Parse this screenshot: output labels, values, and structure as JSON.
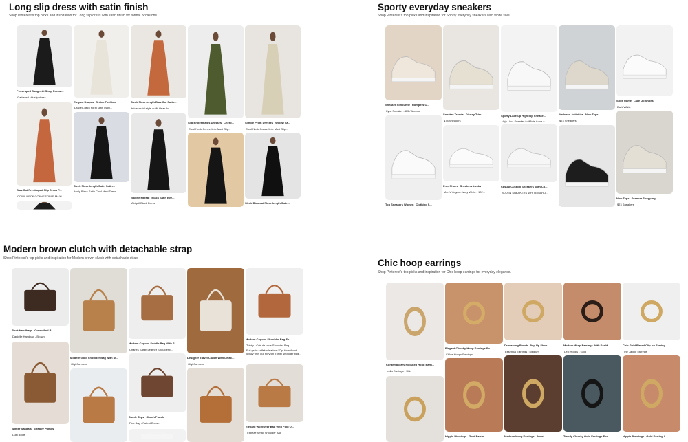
{
  "colors": {
    "background": "#ffffff",
    "title": "#111111",
    "subtitle": "#444444"
  },
  "sections": [
    {
      "id": "dress",
      "title": "Long slip dress with satin finish",
      "subtitle": "Shop Pinterest's top picks and inspiration for Long slip dress with satin finish for formal occasions.",
      "columns": [
        [
          {
            "chips": [
              "Pre-draped Spaghetti Strap Forma..."
            ],
            "caption": "Gathered silk slip dress",
            "bg": "#ececec",
            "fig": "#1b1b1b"
          },
          {
            "chips": [
              "Bias Cut Pre-draped Slip Dress F..."
            ],
            "caption": "COWL-NECK CONVERTIBLE MAXI...",
            "bg": "#eeeae6",
            "fig": "#c4673e"
          },
          {
            "chips": [],
            "caption": "",
            "bg": "#f2f2f2",
            "fig": "#1d1d1d"
          }
        ],
        [
          {
            "chips": [
              "Elegant Drapes",
              "Online Fashion"
            ],
            "caption": "Draped-neck floral satin maxi...",
            "bg": "#f0efec",
            "fig": "#e9e4d9"
          },
          {
            "chips": [
              "Sleek Floor-length Satin Satin..."
            ],
            "caption": "Holly Black Satin Cowl Maxi Dress...",
            "bg": "#d9dde3",
            "fig": "#151515"
          }
        ],
        [
          {
            "chips": [
              "Sleek Floor-length Bias Cut Satin..."
            ],
            "caption": "bridesmaid style outfit ideas for...",
            "bg": "#eae7e3",
            "fig": "#c4683d"
          },
          {
            "chips": [
              "Nadine Merabi",
              "Black Satin Eve..."
            ],
            "caption": "Abigail Black Dress",
            "bg": "#e8e8e8",
            "fig": "#161616"
          }
        ],
        [
          {
            "chips": [
              "Slip Bridesmaids Dresses",
              "Chero..."
            ],
            "caption": "Cowl-Neck Convertible Maxi Slip...",
            "bg": "#ededed",
            "fig": "#4d5b2e"
          },
          {
            "chips": [],
            "caption": "",
            "bg": "#e2c8a3",
            "fig": "#151515"
          }
        ],
        [
          {
            "chips": [
              "Simple Prom Dresses",
              "Willow Sa..."
            ],
            "caption": "Cowl-Neck Convertible Maxi Slip...",
            "bg": "#e8e5e1",
            "fig": "#d8cfb7"
          },
          {
            "chips": [
              "Sleek Bias-cut Floor-length Satin..."
            ],
            "caption": "",
            "bg": "#e4e4e4",
            "fig": "#101010"
          }
        ]
      ]
    },
    {
      "id": "sneakers",
      "title": "Sporty everyday sneakers",
      "subtitle": "Shop Pinterest's top picks and inspiration for Sporty everyday sneakers with white sole.",
      "columns": [
        [
          {
            "chips": [
              "Sneaker Silhouette",
              "Rompers O..."
            ],
            "caption": "Kyra Sneaker - 8.5 / Almond",
            "bg": "#e2d5c6",
            "fig": "#efe7dc"
          },
          {
            "chips": [
              "Top Sneakers Women",
              "Clothing S..."
            ],
            "caption": "",
            "bg": "#efefef",
            "fig": "#fafafa"
          }
        ],
        [
          {
            "chips": [
              "Sneaker Trends",
              "Disney Trim"
            ],
            "caption": "$74 Sneakers",
            "bg": "#e9e6e1",
            "fig": "#e6e0d2"
          },
          {
            "chips": [
              "Free Shoes",
              "Sneakers Looks"
            ],
            "caption": "Men's Vegan - Ivory White - 13 /...",
            "bg": "#f1f1f1",
            "fig": "#fbfbfb"
          }
        ],
        [
          {
            "chips": [
              "Sporty Lace-up High-top Sneake..."
            ],
            "caption": "Veja Urca Sneaker in White Aqua a...",
            "bg": "#f3f3f3",
            "fig": "#f8f8f8"
          },
          {
            "chips": [
              "Casual Custom Sneakers With Co..."
            ],
            "caption": "BODEN SNEAKERS WHITE MARO...",
            "bg": "#eeeeee",
            "fig": "#f6f6f6"
          }
        ],
        [
          {
            "chips": [
              "Wellness Activities",
              "New Tops"
            ],
            "caption": "$74 Sneakers",
            "bg": "#cfd3d6",
            "fig": "#ddd8cb"
          },
          {
            "chips": [],
            "caption": "",
            "bg": "#e6e6e6",
            "fig": "#1d1d1d"
          }
        ],
        [
          {
            "chips": [
              "Shoe Game",
              "Lace Up Shoes"
            ],
            "caption": "Dark White",
            "bg": "#f2f2f2",
            "fig": "#fbfbfb"
          },
          {
            "chips": [
              "New Tops",
              "Sneaker Shopping"
            ],
            "caption": "$74 Sneakers",
            "bg": "#d9d5cf",
            "fig": "#e4dfd4"
          }
        ]
      ]
    },
    {
      "id": "clutch",
      "title": "Modern brown clutch with detachable strap",
      "subtitle": "Shop Pinterest's top picks and inspiration for Modern brown clutch with detachable strap.",
      "columns": [
        [
          {
            "chips": [
              "Rock Handbags",
              "Green And B..."
            ],
            "caption": "Danielle Handbag - Brown",
            "bg": "#ececec",
            "fig": "#3d2a20"
          },
          {
            "chips": [
              "Winter Sandals",
              "Strappy Pumps"
            ],
            "caption": "Lulu Boots",
            "bg": "#e5ddd5",
            "fig": "#8a5a34"
          }
        ],
        [
          {
            "chips": [
              "Modern Gold Shoulder Bag With St..."
            ],
            "caption": "Gigi Carmelo",
            "bg": "#e0dcd6",
            "fig": "#b8804a"
          },
          {
            "chips": [],
            "caption": "",
            "bg": "#e9edf0",
            "fig": "#b97a45"
          }
        ],
        [
          {
            "chips": [
              "Modern Cognac Saddle Bag With S..."
            ],
            "caption": "Charles Safari Leather Shoulder B...",
            "bg": "#eeeeee",
            "fig": "#a86e43"
          },
          {
            "chips": [
              "Suede Tops",
              "Clutch Pouch"
            ],
            "caption": "Flex Bag - Patent Brown",
            "bg": "#eeeeee",
            "fig": "#6e4632"
          },
          {
            "chips": [],
            "caption": "",
            "bg": "#f2f2f2",
            "fig": "#f5f5f5"
          }
        ],
        [
          {
            "chips": [
              "Designer Travel Clutch With Detac..."
            ],
            "caption": "Gigi Carmelo",
            "bg": "#9e6a3e",
            "fig": "#e8e2d9"
          },
          {
            "chips": [],
            "caption": "",
            "bg": "#e3ddd6",
            "fig": "#b36f37"
          }
        ],
        [
          {
            "chips": [
              "Modern Cognac Shoulder Bag Fo..."
            ],
            "caption": "Trinity • Cuir de vous Shoulder Bag",
            "bg": "#efefef",
            "fig": "#b2683c"
          },
          {
            "chips": [
              "Elegant Workwear Bag With Fold O..."
            ],
            "caption": "Trapeze Small Shoulder Bag",
            "bg": "#e2ddd6",
            "fig": "#b97a45"
          }
        ]
      ],
      "extra_caption": "Full grain calfskin leather / Opt for refined luxury with our Flevron Trinity shoulder bag..."
    },
    {
      "id": "earrings",
      "title": "Chic hoop earrings",
      "subtitle": "Shop Pinterest's top picks and inspiration for Chic hoop earrings for everyday elegance.",
      "columns": [
        [
          {
            "chips": [
              "Contemporary Polished Hoop Earri..."
            ],
            "caption": "India Earrings - Silk",
            "bg": "#ebe8e5",
            "fig": "#caa56c"
          },
          {
            "chips": [],
            "caption": "",
            "bg": "#e4e1dc",
            "fig": "#c9a15d"
          }
        ],
        [
          {
            "chips": [
              "Elegant Chunky Hoop Earrings Fo..."
            ],
            "caption": "Chloe Hoops Earrings",
            "bg": "#c8926b",
            "fig": "#d4ac68"
          },
          {
            "chips": [
              "Hippie Piercings",
              "Gold Earrin..."
            ],
            "caption": "",
            "bg": "#b97a58",
            "fig": "#d2aa66"
          }
        ],
        [
          {
            "chips": [
              "Drawstring Pouch",
              "Pop Up Shop"
            ],
            "caption": "Essential Earrings | Medium",
            "bg": "#e3ccb8",
            "fig": "#cfa963"
          },
          {
            "chips": [
              "Medium Hoop Earrings",
              "Jewel..."
            ],
            "caption": "",
            "bg": "#5c3e30",
            "fig": "#cfa963"
          }
        ],
        [
          {
            "chips": [
              "Modern Wrap Earrings With Ear H..."
            ],
            "caption": "Lexi Hoops - Gold",
            "bg": "#c48c6a",
            "fig": "#2b1d17"
          },
          {
            "chips": [
              "Trendy Chunky Gold Earrings For..."
            ],
            "caption": "",
            "bg": "#4a5960",
            "fig": "#151515"
          }
        ],
        [
          {
            "chips": [
              "Chic Gold Plated Clip-on Earring..."
            ],
            "caption": "The Jackie earrings",
            "bg": "#efefef",
            "fig": "#cfa963"
          },
          {
            "chips": [
              "Hippie Piercings",
              "Gold Earring A..."
            ],
            "caption": "",
            "bg": "#c78b6b",
            "fig": "#cfa963"
          }
        ]
      ]
    }
  ]
}
